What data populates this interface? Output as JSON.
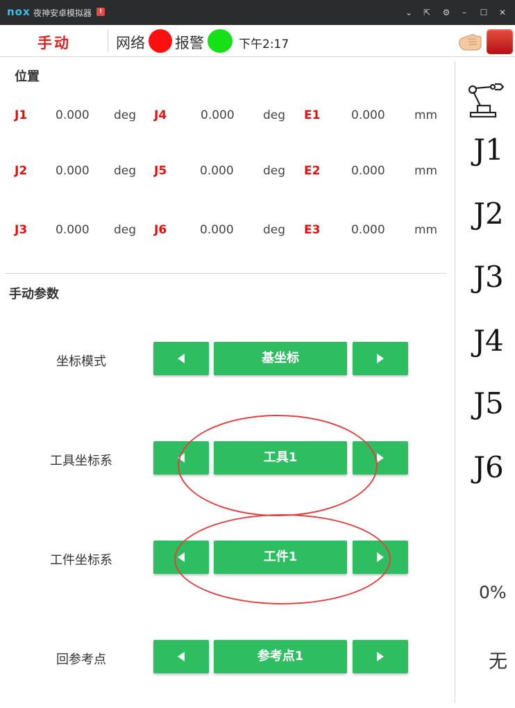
{
  "window": {
    "logo": "nox",
    "title": "夜神安卓模拟器",
    "warning_badge": "!",
    "controls": [
      "chevron-down",
      "pin",
      "settings",
      "minimize",
      "maximize",
      "close"
    ]
  },
  "header": {
    "mode": "手动",
    "network_label": "网络",
    "network_status_color": "#ff1010",
    "alarm_label": "报警",
    "alarm_status_color": "#16e016",
    "time": "下午2:17"
  },
  "position": {
    "title": "位置",
    "rows": [
      [
        {
          "axis": "J1",
          "value": "0.000",
          "unit": "deg"
        },
        {
          "axis": "J4",
          "value": "0.000",
          "unit": "deg"
        },
        {
          "axis": "E1",
          "value": "0.000",
          "unit": "mm"
        }
      ],
      [
        {
          "axis": "J2",
          "value": "0.000",
          "unit": "deg"
        },
        {
          "axis": "J5",
          "value": "0.000",
          "unit": "deg"
        },
        {
          "axis": "E2",
          "value": "0.000",
          "unit": "mm"
        }
      ],
      [
        {
          "axis": "J3",
          "value": "0.000",
          "unit": "deg"
        },
        {
          "axis": "J6",
          "value": "0.000",
          "unit": "deg"
        },
        {
          "axis": "E3",
          "value": "0.000",
          "unit": "mm"
        }
      ]
    ]
  },
  "manual_params": {
    "title": "手动参数",
    "rows": [
      {
        "label": "坐标模式",
        "value": "基坐标"
      },
      {
        "label": "工具坐标系",
        "value": "工具1"
      },
      {
        "label": "工件坐标系",
        "value": "工件1"
      },
      {
        "label": "回参考点",
        "value": "参考点1"
      }
    ]
  },
  "jog_panel": {
    "axes": [
      "J1",
      "J2",
      "J3",
      "J4",
      "J5",
      "J6"
    ],
    "speed": "0%",
    "status": "无"
  },
  "colors": {
    "accent_green": "#2fbd62",
    "axis_red": "#e01010",
    "annotation_red": "#e04040"
  }
}
